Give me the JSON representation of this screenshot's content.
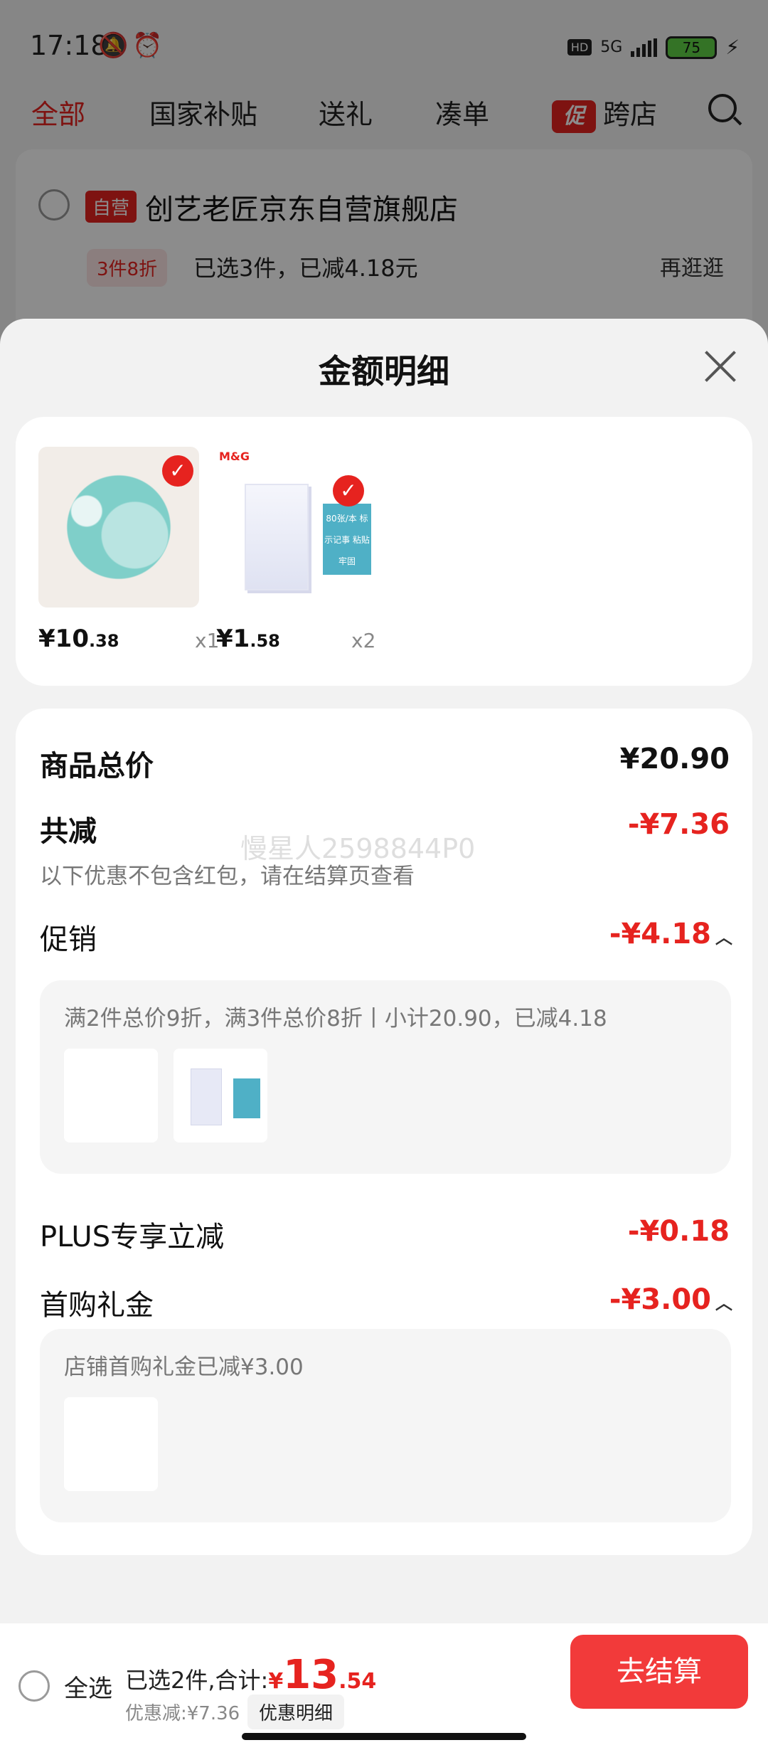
{
  "status_bar": {
    "time": "17:18",
    "hd": "HD",
    "network": "5G",
    "battery": "75"
  },
  "top_tabs": {
    "items": [
      "全部",
      "国家补贴",
      "送礼",
      "凑单",
      "跨店"
    ],
    "promo_mark": "促"
  },
  "store": {
    "tag": "自营",
    "name": "创艺老匠京东自营旗舰店",
    "promo_chip": "3件8折",
    "promo_text": "已选3件，已减4.18元",
    "more": "再逛逛"
  },
  "sheet": {
    "title": "金额明细"
  },
  "products": [
    {
      "price_int": "¥10",
      "price_dec": ".38",
      "qty": "x1"
    },
    {
      "price_int": "¥1",
      "price_dec": ".58",
      "qty": "x2"
    }
  ],
  "product_image_text": {
    "note_tag": "80张/本 标示记事 粘贴牢固",
    "brand": "M&G"
  },
  "details": {
    "subtotal_label": "商品总价",
    "subtotal_value": "¥20.90",
    "total_reduce_label": "共减",
    "total_reduce_value": "-¥7.36",
    "note": "以下优惠不包含红包，请在结算页查看",
    "watermark": "慢星人2598844P0",
    "promo_label": "促销",
    "promo_value": "-¥4.18",
    "promo_desc": "满2件总价9折，满3件总价8折丨小计20.90，已减4.18",
    "plus_label": "PLUS专享立减",
    "plus_value": "-¥0.18",
    "gift_label": "首购礼金",
    "gift_value": "-¥3.00",
    "gift_desc": "店铺首购礼金已减¥3.00"
  },
  "bottom_bar": {
    "select_all": "全选",
    "selected_text": "已选2件,合计:",
    "currency": "¥",
    "total_int": "13",
    "total_dec": ".54",
    "discount_text": "优惠减:¥7.36",
    "discount_detail_button": "优惠明细",
    "checkout_button": "去结算"
  },
  "colors": {
    "accent_red": "#e6231f",
    "checkout_red": "#f23a3a"
  }
}
